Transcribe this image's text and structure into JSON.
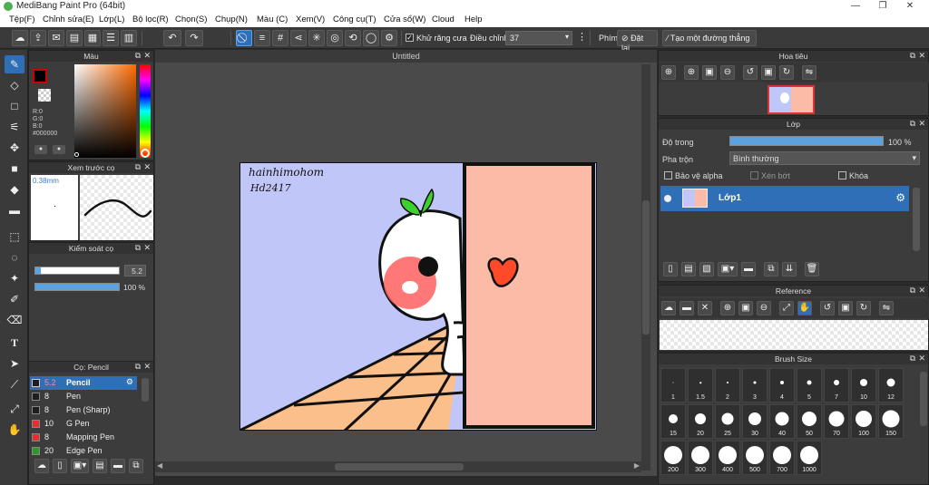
{
  "app": {
    "title": "MediBang Paint Pro (64bit)"
  },
  "window_controls": {
    "minimize": "—",
    "restore": "❐",
    "close": "✕"
  },
  "menu": [
    "Tệp(F)",
    "Chỉnh sửa(E)",
    "Lớp(L)",
    "Bộ lọc(R)",
    "Chọn(S)",
    "Chụp(N)",
    "Màu (C)",
    "Xem(V)",
    "Công cụ(T)",
    "Cửa sổ(W)",
    "Cloud",
    "Help"
  ],
  "toolbar": {
    "antialias_label": "Khử răng cưa",
    "adjust_label": "Điều chỉnh",
    "adjust_value": "37",
    "key_label": "Phím",
    "reset_label": "Đặt lại",
    "make_line_label": "Tạo một đường thẳng"
  },
  "color_panel": {
    "title": "Màu",
    "r": "R:0",
    "g": "G:0",
    "b": "B:0",
    "hex": "#000000"
  },
  "preview_panel": {
    "title": "Xem trước cọ",
    "size": "0.38mm"
  },
  "brush_control": {
    "title": "Kiểm soát cọ",
    "size_value": "5.2",
    "size_fraction": 0.06,
    "opacity_value": "100 %",
    "opacity_fraction": 1.0
  },
  "brush_list": {
    "title": "Cọ: Pencil",
    "items": [
      {
        "size": "5.2",
        "name": "Pencil",
        "color": "#1e1e1e",
        "selected": true
      },
      {
        "size": "8",
        "name": "Pen",
        "color": "#1e1e1e",
        "selected": false
      },
      {
        "size": "8",
        "name": "Pen (Sharp)",
        "color": "#1e1e1e",
        "selected": false
      },
      {
        "size": "10",
        "name": "G Pen",
        "color": "#e03030",
        "selected": false
      },
      {
        "size": "8",
        "name": "Mapping Pen",
        "color": "#e03030",
        "selected": false
      },
      {
        "size": "20",
        "name": "Edge Pen",
        "color": "#2a9a2a",
        "selected": false
      }
    ]
  },
  "canvas": {
    "doc_title": "Untitled",
    "signature_line1": "hainhimohom",
    "signature_line2": "Hd2417"
  },
  "navigator": {
    "title": "Hoa tiêu"
  },
  "layer_panel": {
    "title": "Lớp",
    "opacity_label": "Độ trong",
    "opacity_value": "100 %",
    "opacity_fraction": 1.0,
    "blend_label": "Pha trộn",
    "blend_value": "Bình thường",
    "protect_alpha": "Bảo vệ alpha",
    "clipping": "Xén bớt",
    "lock": "Khóa",
    "layers": [
      {
        "name": "Lớp1"
      }
    ]
  },
  "reference_panel": {
    "title": "Reference"
  },
  "brush_size_panel": {
    "title": "Brush Size",
    "sizes": [
      "1",
      "1.5",
      "2",
      "3",
      "4",
      "5",
      "7",
      "10",
      "12",
      "15",
      "20",
      "25",
      "30",
      "40",
      "50",
      "70",
      "100",
      "150",
      "200",
      "300",
      "400",
      "500",
      "700",
      "1000"
    ]
  },
  "colors": {
    "accent": "#2f6fb7",
    "panel_bg": "#3c3c3c",
    "canvas_bg": "#4a4a4a",
    "sky": "#c1c6f8",
    "door": "#fbbba6",
    "floor": "#fbbf8c",
    "sprout": "#3bd12e"
  }
}
